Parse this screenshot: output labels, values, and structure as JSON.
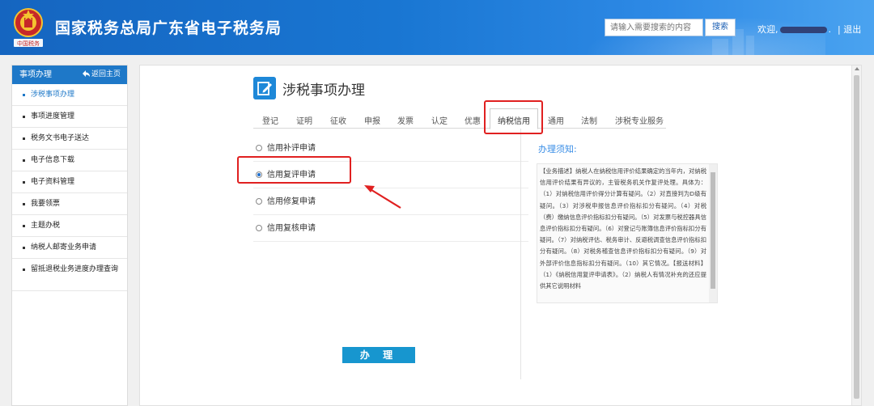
{
  "header": {
    "site_title": "国家税务总局广东省电子税务局",
    "emblem_text": "中国税务",
    "search_placeholder": "请输入需要搜索的内容",
    "search_button": "搜索",
    "welcome": "欢迎,",
    "welcome_suffix": ".",
    "logout": "| 退出"
  },
  "sidebar": {
    "title": "事项办理",
    "back_label": "返回主页",
    "items": [
      {
        "label": "涉税事项办理"
      },
      {
        "label": "事项进度管理"
      },
      {
        "label": "税务文书电子送达"
      },
      {
        "label": "电子信息下载"
      },
      {
        "label": "电子资料管理"
      },
      {
        "label": "我要领票"
      },
      {
        "label": "主题办税"
      },
      {
        "label": "纳税人邮寄业务申请"
      },
      {
        "label": "留抵退税业务进度办理查询"
      }
    ]
  },
  "main": {
    "page_title": "涉税事项办理",
    "tabs": [
      {
        "label": "登记"
      },
      {
        "label": "证明"
      },
      {
        "label": "征收"
      },
      {
        "label": "申报"
      },
      {
        "label": "发票"
      },
      {
        "label": "认定"
      },
      {
        "label": "优惠"
      },
      {
        "label": "纳税信用"
      },
      {
        "label": "通用"
      },
      {
        "label": "法制"
      },
      {
        "label": "涉税专业服务"
      }
    ],
    "active_tab": "纳税信用",
    "options": [
      {
        "label": "信用补评申请",
        "checked": false
      },
      {
        "label": "信用复评申请",
        "checked": true
      },
      {
        "label": "信用修复申请",
        "checked": false
      },
      {
        "label": "信用复核申请",
        "checked": false
      }
    ],
    "notice_title": "办理须知:",
    "notice_text": "【业务描述】纳税人在纳税信用评价结果确定的当年内，对纳税信用评价结果有异议的，主管税务机关作复评处理。具体为：（1）对纳税信用评价得分计算有疑问。（2）对直接判为D级有疑问。（3）对涉税申报信息评价指标扣分有疑问。（4）对税（费）缴纳信息评价指标扣分有疑问。（5）对发票与税控器具信息评价指标扣分有疑问。（6）对登记与账簿信息评价指标扣分有疑问。（7）对纳税评估、税务审计、反避税调查信息评价指标扣分有疑问。（8）对税务稽查信息评价指标扣分有疑问。（9）对外部评价信息指标扣分有疑问。（10）其它情况。【报送材料】（1）《纳税信用复评申请表》。（2）纳税人有情况补充的还应提供其它说明材料",
    "submit_button": "办 理"
  },
  "colors": {
    "header_blue": "#1976d2",
    "accent_blue": "#1e78c8",
    "annotation_red": "#e02020"
  }
}
